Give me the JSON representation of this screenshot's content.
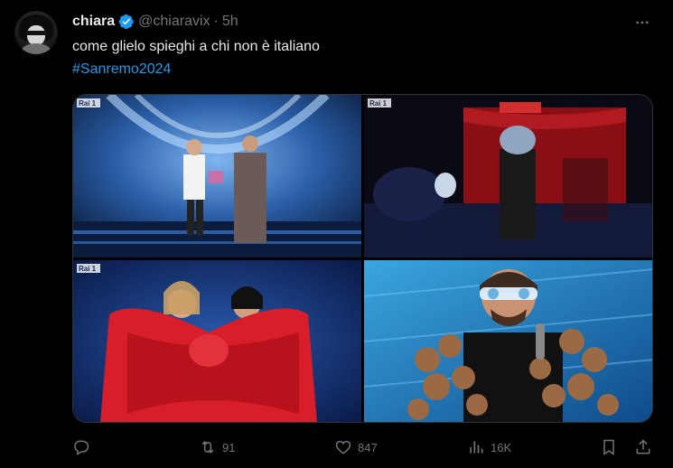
{
  "tweet": {
    "author_name": "chiara",
    "handle": "@chiaravix",
    "separator": "·",
    "time": "5h",
    "text": "come glielo spieghi a chi non è italiano",
    "hashtag": "#Sanremo2024",
    "media": [
      {
        "icon": "stage-photo",
        "logo": "Rai 1"
      },
      {
        "icon": "audience-photo",
        "logo": "Rai 1"
      },
      {
        "icon": "red-bow-photo",
        "logo": "Rai 1"
      },
      {
        "icon": "teddy-bears-photo",
        "logo": ""
      }
    ]
  },
  "actions": {
    "replies": "",
    "retweets": "91",
    "likes": "847",
    "views": "16K"
  },
  "colors": {
    "background": "#000000",
    "text": "#e7e9ea",
    "secondary": "#71767b",
    "accent": "#1d9bf0",
    "border": "#2f3336"
  }
}
